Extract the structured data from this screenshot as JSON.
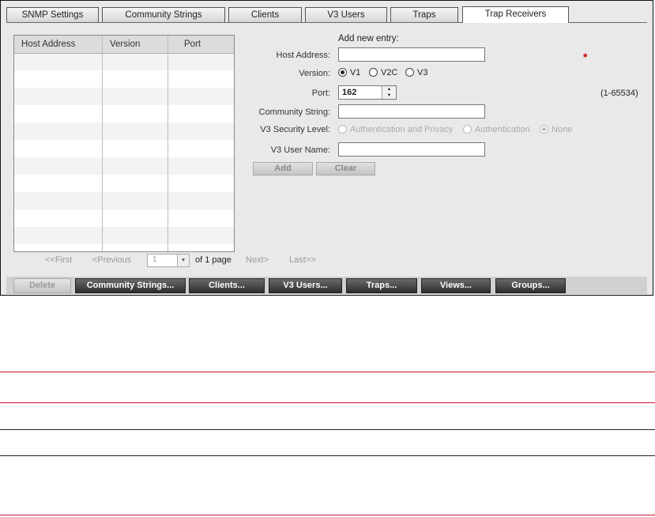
{
  "tabs": [
    "SNMP Settings",
    "Community Strings",
    "Clients",
    "V3 Users",
    "Traps",
    "Trap Receivers"
  ],
  "table": {
    "columns": [
      "Host Address",
      "Version",
      "Port"
    ]
  },
  "pager": {
    "first": "<<First",
    "previous": "<Previous",
    "page_value": "1",
    "of_pages": "of 1 page",
    "next": "Next>",
    "last": "Last>>"
  },
  "form": {
    "heading": "Add new entry:",
    "host_label": "Host Address:",
    "host_value": "",
    "required_mark": "*",
    "version_label": "Version:",
    "version_options": [
      "V1",
      "V2C",
      "V3"
    ],
    "version_selected": "V1",
    "port_label": "Port:",
    "port_value": "162",
    "port_range": "(1-65534)",
    "community_label": "Community String:",
    "community_value": "",
    "security_label": "V3 Security Level:",
    "security_options": [
      "Authentication and Privacy",
      "Authentication",
      "None"
    ],
    "security_selected": "None",
    "v3user_label": "V3 User Name:",
    "v3user_value": "",
    "add_label": "Add",
    "clear_label": "Clear"
  },
  "bottom_buttons": [
    "Delete",
    "Community Strings...",
    "Clients...",
    "V3 Users...",
    "Traps...",
    "Views...",
    "Groups..."
  ],
  "colors": {
    "required": "#cc0000",
    "rule_red": "#c8102e",
    "rule_black": "#222222"
  }
}
